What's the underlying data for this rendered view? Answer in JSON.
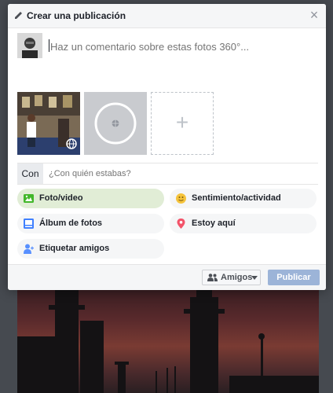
{
  "dialog": {
    "title": "Crear una publicación",
    "close_symbol": "×"
  },
  "composer": {
    "placeholder": "Haz un comentario sobre estas fotos 360°..."
  },
  "attachments": {
    "add_symbol": "+"
  },
  "with_row": {
    "label": "Con",
    "placeholder": "¿Con quién estabas?"
  },
  "options": [
    {
      "label": "Foto/video",
      "icon": "photo-icon",
      "color": "#42b72a"
    },
    {
      "label": "Sentimiento/actividad",
      "icon": "smiley-icon",
      "color": "#f5c33b"
    },
    {
      "label": "Álbum de fotos",
      "icon": "album-icon",
      "color": "#4080ff"
    },
    {
      "label": "Estoy aquí",
      "icon": "location-pin-icon",
      "color": "#f35369"
    },
    {
      "label": "Etiquetar amigos",
      "icon": "tag-friends-icon",
      "color": "#5890ff"
    }
  ],
  "footer": {
    "audience_label": "Amigos",
    "publish_label": "Publicar"
  },
  "colors": {
    "accent": "#4267b2",
    "publish_disabled": "#9cb4d8",
    "active_option": "#e1edd6"
  }
}
